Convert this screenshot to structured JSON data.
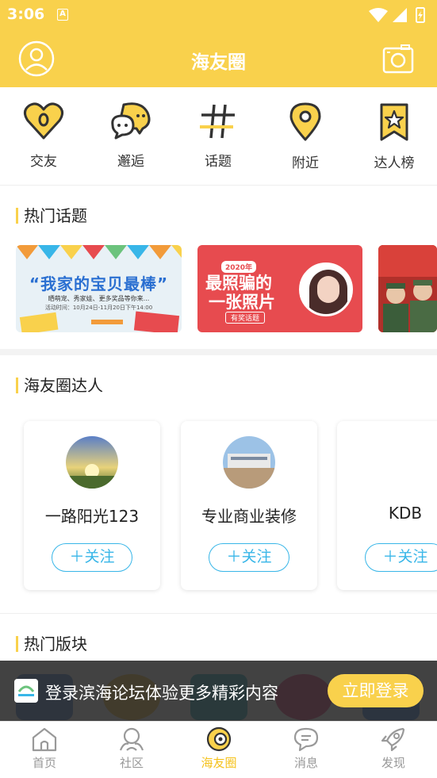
{
  "status_bar": {
    "time": "3:06",
    "indicator": "A"
  },
  "header": {
    "title": "海友圈"
  },
  "categories": [
    {
      "label": "交友",
      "icon": "heart-icon"
    },
    {
      "label": "邂逅",
      "icon": "chat-bubbles-icon"
    },
    {
      "label": "话题",
      "icon": "hashtag-icon"
    },
    {
      "label": "附近",
      "icon": "location-pin-icon"
    },
    {
      "label": "达人榜",
      "icon": "star-bookmark-icon"
    }
  ],
  "hot_topics": {
    "title": "热门话题",
    "cards": [
      {
        "headline": "“我家的宝贝最棒”",
        "subline": "晒萌宠、秀家娃、更多奖品等你来...",
        "date_line": "活动时间：10月24日-11月20日下午14:00"
      },
      {
        "badge": "2020年",
        "line1": "最照骗的",
        "line2": "一张照片",
        "tag": "有奖话题"
      },
      {}
    ]
  },
  "talents": {
    "title": "海友圈达人",
    "follow_label": "＋关注",
    "people": [
      {
        "name": "一路阳光123"
      },
      {
        "name": "专业商业装修"
      },
      {
        "name": "KDB"
      }
    ]
  },
  "boards": {
    "title": "热门版块"
  },
  "login_banner": {
    "text": "登录滨海论坛体验更多精彩内容",
    "button": "立即登录"
  },
  "tabbar": [
    {
      "label": "首页",
      "icon": "home-icon"
    },
    {
      "label": "社区",
      "icon": "community-icon"
    },
    {
      "label": "海友圈",
      "icon": "circle-icon",
      "active": true
    },
    {
      "label": "消息",
      "icon": "message-icon"
    },
    {
      "label": "发现",
      "icon": "rocket-icon"
    }
  ],
  "colors": {
    "primary": "#f9d14c",
    "accent_blue": "#38b6e8",
    "active_tab": "#f5c21b"
  }
}
